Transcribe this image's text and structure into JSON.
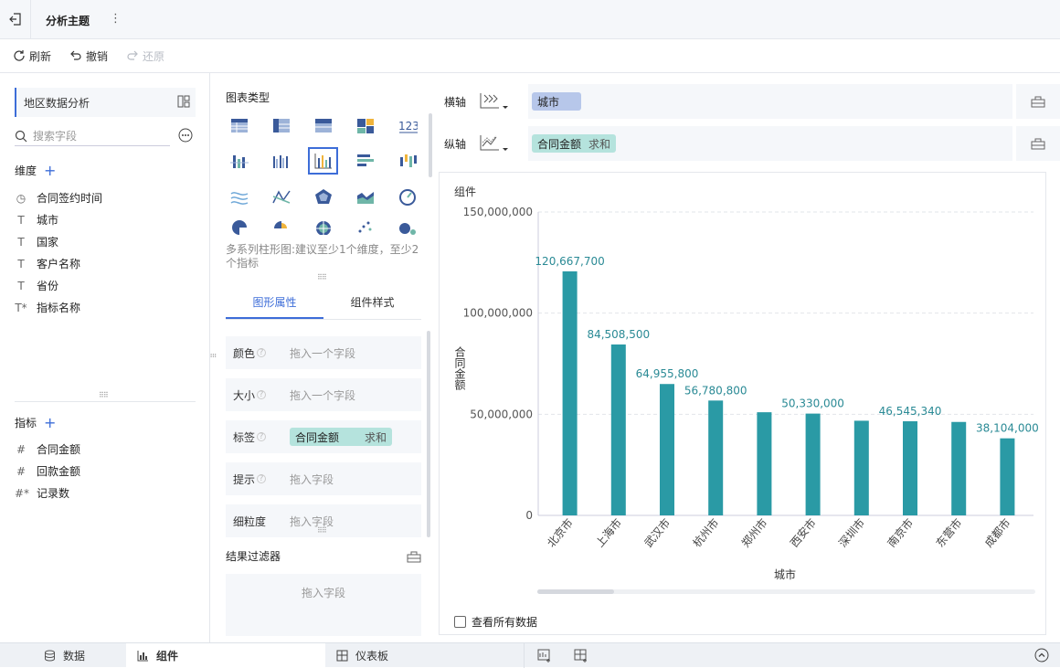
{
  "topbar": {
    "title": "分析主题"
  },
  "toolbar": {
    "refresh": "刷新",
    "undo": "撤销",
    "redo": "还原"
  },
  "left": {
    "dataset": "地区数据分析",
    "search_placeholder": "搜索字段",
    "dimensions_title": "维度",
    "dimensions": [
      {
        "icon": "clock-icon",
        "glyph": "◷",
        "label": "合同签约时间"
      },
      {
        "icon": "text-field-icon",
        "glyph": "T",
        "label": "城市"
      },
      {
        "icon": "text-field-icon",
        "glyph": "T",
        "label": "国家"
      },
      {
        "icon": "text-field-icon",
        "glyph": "T",
        "label": "客户名称"
      },
      {
        "icon": "text-field-icon",
        "glyph": "T",
        "label": "省份"
      },
      {
        "icon": "calc-text-field-icon",
        "glyph": "T*",
        "label": "指标名称"
      }
    ],
    "measures_title": "指标",
    "measures": [
      {
        "icon": "number-field-icon",
        "glyph": "#",
        "label": "合同金额"
      },
      {
        "icon": "number-field-icon",
        "glyph": "#",
        "label": "回款金额"
      },
      {
        "icon": "calc-number-field-icon",
        "glyph": "#*",
        "label": "记录数"
      }
    ]
  },
  "middle": {
    "chart_type_title": "图表类型",
    "chart_hint": "多系列柱形图:建议至少1个维度，至少2个指标",
    "tabs": [
      "图形属性",
      "组件样式"
    ],
    "props": [
      {
        "name": "颜色",
        "value": "拖入一个字段"
      },
      {
        "name": "大小",
        "value": "拖入一个字段"
      },
      {
        "name": "标签",
        "pill": "合同金额",
        "agg": "求和"
      },
      {
        "name": "提示",
        "value": "拖入字段"
      },
      {
        "name": "细粒度",
        "value": "拖入字段"
      }
    ],
    "filter_title": "结果过滤器",
    "filter_placeholder": "拖入字段"
  },
  "right": {
    "x_axis": {
      "label": "横轴",
      "field": "城市"
    },
    "y_axis": {
      "label": "纵轴",
      "field": "合同金额",
      "agg": "求和"
    },
    "card_title": "组件",
    "view_all": "查看所有数据"
  },
  "chart_data": {
    "type": "bar",
    "categories": [
      "北京市",
      "上海市",
      "武汉市",
      "杭州市",
      "郑州市",
      "西安市",
      "深圳市",
      "南京市",
      "东营市",
      "成都市"
    ],
    "values": [
      120667700,
      84508500,
      64955800,
      56780800,
      51000000,
      50330000,
      46800000,
      46545340,
      46200000,
      38104000
    ],
    "data_labels": [
      "120,667,700",
      "84,508,500",
      "64,955,800",
      "56,780,800",
      "",
      "50,330,000",
      "",
      "46,545,340",
      "",
      "38,104,000"
    ],
    "yticks": [
      "150,000,000",
      "100,000,000",
      "50,000,000",
      "0"
    ],
    "xlabel": "城市",
    "ylabel": "合同金额",
    "ylim": [
      0,
      150000000
    ],
    "bar_color": "#2a9aa5",
    "grid": true
  },
  "bottom": {
    "tabs": [
      {
        "label": "数据"
      },
      {
        "label": "组件"
      },
      {
        "label": "仪表板"
      }
    ]
  }
}
